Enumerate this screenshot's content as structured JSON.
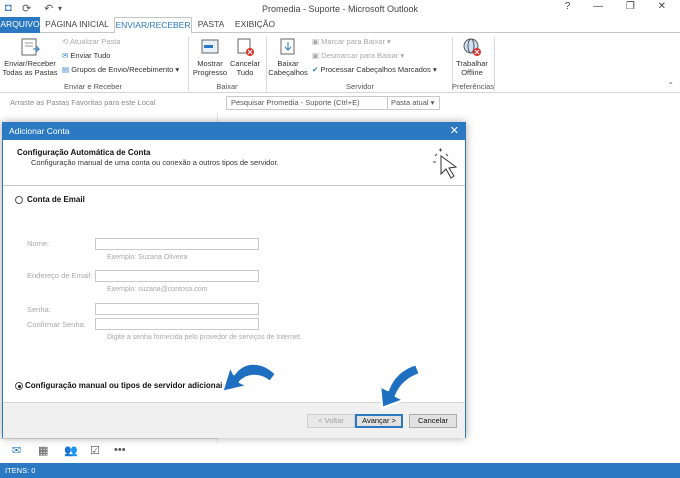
{
  "window": {
    "title": "Promedia - Suporte - Microsoft Outlook",
    "controls": "? — ❐ ✕"
  },
  "ribbon_tabs": [
    "ARQUIVO",
    "PÁGINA INICIAL",
    "ENVIAR/RECEBER",
    "PASTA",
    "EXIBIÇÃO"
  ],
  "ribbon": {
    "send_receive_all": "Enviar/Receber Todas as Pastas",
    "update_folder": "Atualizar Pasta",
    "send_all": "Enviar Tudo",
    "send_receive_groups": "Grupos de Envio/Recebimento",
    "group1_label": "Enviar e Receber",
    "show_progress": "Mostrar Progresso",
    "cancel_all": "Cancelar Tudo",
    "group2_label": "Baixar",
    "download_headers": "Baixar Cabeçalhos",
    "mark_download": "Marcar para Baixar",
    "unmark_download": "Desmarcar para Baixar",
    "process_headers": "Processar Cabeçalhos Marcados",
    "group3_label": "Servidor",
    "work_offline": "Trabalhar Offline",
    "group4_label": "Preferências"
  },
  "main": {
    "favorites_hint": "Arraste as Pastas Favoritas para este Local",
    "search_placeholder": "Pesquisar Promedia - Suporte (Ctrl+E)",
    "search_scope": "Pasta atual"
  },
  "status": {
    "items": "ITENS: 0"
  },
  "dialog": {
    "title": "Adicionar Conta",
    "heading": "Configuração Automática de Conta",
    "subheading": "Configuração manual de uma conta ou conexão a outros tipos de servidor.",
    "option_email": "Conta de Email",
    "label_name": "Nome:",
    "hint_name": "Exemplo: Suzana Oliveira",
    "label_email": "Endereço de Email:",
    "hint_email": "Exemplo: suzana@contoso.com",
    "label_password": "Senha:",
    "label_confirm": "Confirmar Senha:",
    "hint_password": "Digite a senha fornecida pelo provedor de serviços de Internet.",
    "option_manual": "Configuração manual ou tipos de servidor adicionais",
    "btn_back": "< Voltar",
    "btn_next": "Avançar >",
    "btn_cancel": "Cancelar"
  },
  "colors": {
    "accent": "#2b79c2",
    "arrow": "#1f6fc0"
  }
}
